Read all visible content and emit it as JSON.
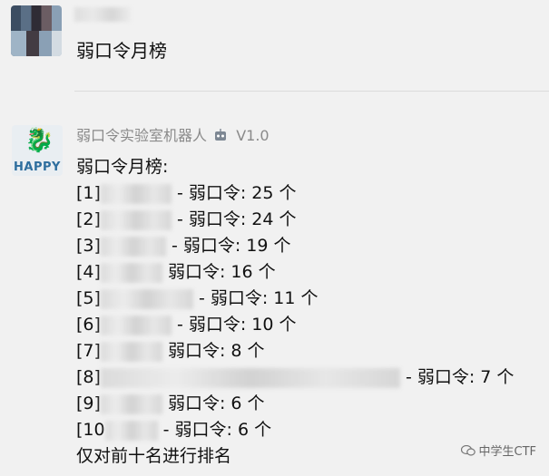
{
  "user_message": {
    "text": "弱口令月榜"
  },
  "bot": {
    "name": "弱口令实验室机器人",
    "version": "V1.0",
    "avatar_text": "HAPPY",
    "title": "弱口令月榜:",
    "entries": [
      {
        "rank": "[1]",
        "suffix": " - 弱口令: 25 个"
      },
      {
        "rank": "[2]",
        "suffix": " - 弱口令: 24 个"
      },
      {
        "rank": "[3]",
        "suffix": " - 弱口令: 19 个"
      },
      {
        "rank": "[4]",
        "suffix": " 弱口令: 16 个"
      },
      {
        "rank": "[5]",
        "suffix": " - 弱口令: 11 个"
      },
      {
        "rank": "[6]",
        "suffix": " - 弱口令: 10 个"
      },
      {
        "rank": "[7]",
        "suffix": " 弱口令: 8 个"
      },
      {
        "rank": "[8]",
        "suffix": " - 弱口令: 7 个"
      },
      {
        "rank": "[9]",
        "suffix": " 弱口令: 6 个"
      },
      {
        "rank": "[10",
        "suffix": " - 弱口令: 6 个"
      }
    ],
    "footer": "仅对前十名进行排名"
  },
  "watermark": {
    "text": "中学生CTF"
  }
}
